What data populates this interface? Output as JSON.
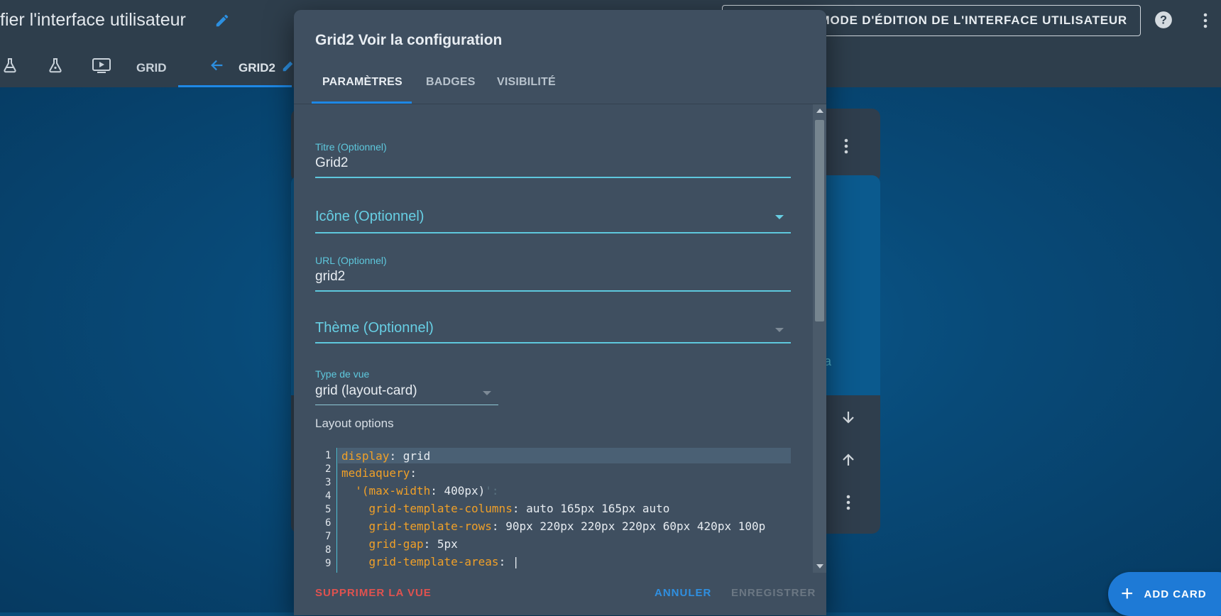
{
  "header": {
    "title": "fier l'interface utilisateur",
    "edit_mode_button": "MODE D'ÉDITION DE L'INTERFACE UTILISATEUR"
  },
  "view_tabs": [
    {
      "label": "GRID"
    },
    {
      "label": "GRID2"
    }
  ],
  "background": {
    "card_text_fragment": "ra",
    "add_card_label": "ADD CARD"
  },
  "dialog": {
    "title": "Grid2 Voir la configuration",
    "tabs": [
      {
        "label": "PARAMÈTRES",
        "active": true
      },
      {
        "label": "BADGES",
        "active": false
      },
      {
        "label": "VISIBILITÉ",
        "active": false
      }
    ],
    "fields": {
      "title": {
        "label": "Titre (Optionnel)",
        "value": "Grid2"
      },
      "icon": {
        "label": "Icône (Optionnel)"
      },
      "url": {
        "label": "URL (Optionnel)",
        "value": "grid2"
      },
      "theme": {
        "label": "Thème (Optionnel)"
      },
      "view_type": {
        "label": "Type de vue",
        "value": "grid (layout-card)"
      }
    },
    "layout_options_label": "Layout options",
    "code": {
      "line_numbers": [
        "1",
        "2",
        "3",
        "4",
        "5",
        "6",
        "7",
        "8",
        "9"
      ],
      "lines": [
        {
          "key": "display",
          "value": " grid"
        },
        {
          "key": "mediaquery",
          "value": ""
        },
        {
          "indent": "  ",
          "string": "'(max-width",
          "value": ": 400px)",
          "tail": "':"
        },
        {
          "indent": "    ",
          "key": "grid-template-columns",
          "value": " auto 165px 165px auto"
        },
        {
          "indent": "    ",
          "key": "grid-template-rows",
          "value": " 90px 220px 220px 220px 60px 420px 100p"
        },
        {
          "indent": "    ",
          "key": "grid-gap",
          "value": " 5px"
        },
        {
          "indent": "    ",
          "key": "grid-template-areas",
          "value": " |"
        }
      ]
    },
    "footer": {
      "delete_label": "SUPPRIMER LA VUE",
      "cancel_label": "ANNULER",
      "save_label": "ENREGISTRER"
    }
  },
  "colors": {
    "accent": "#1e88e5",
    "field_accent": "#5ec8dd",
    "danger": "#e0524f",
    "code_key": "#f0a028",
    "dialog_bg": "#3f4f60",
    "topbar_bg": "#2e3e4c"
  },
  "icons": [
    "pencil-icon",
    "help-icon",
    "more-vert-icon",
    "flask-icon",
    "flask-outline-icon",
    "play-box-icon",
    "arrow-left-icon",
    "arrow-down-icon",
    "arrow-up-icon",
    "plus-icon",
    "dropdown-caret-icon"
  ]
}
